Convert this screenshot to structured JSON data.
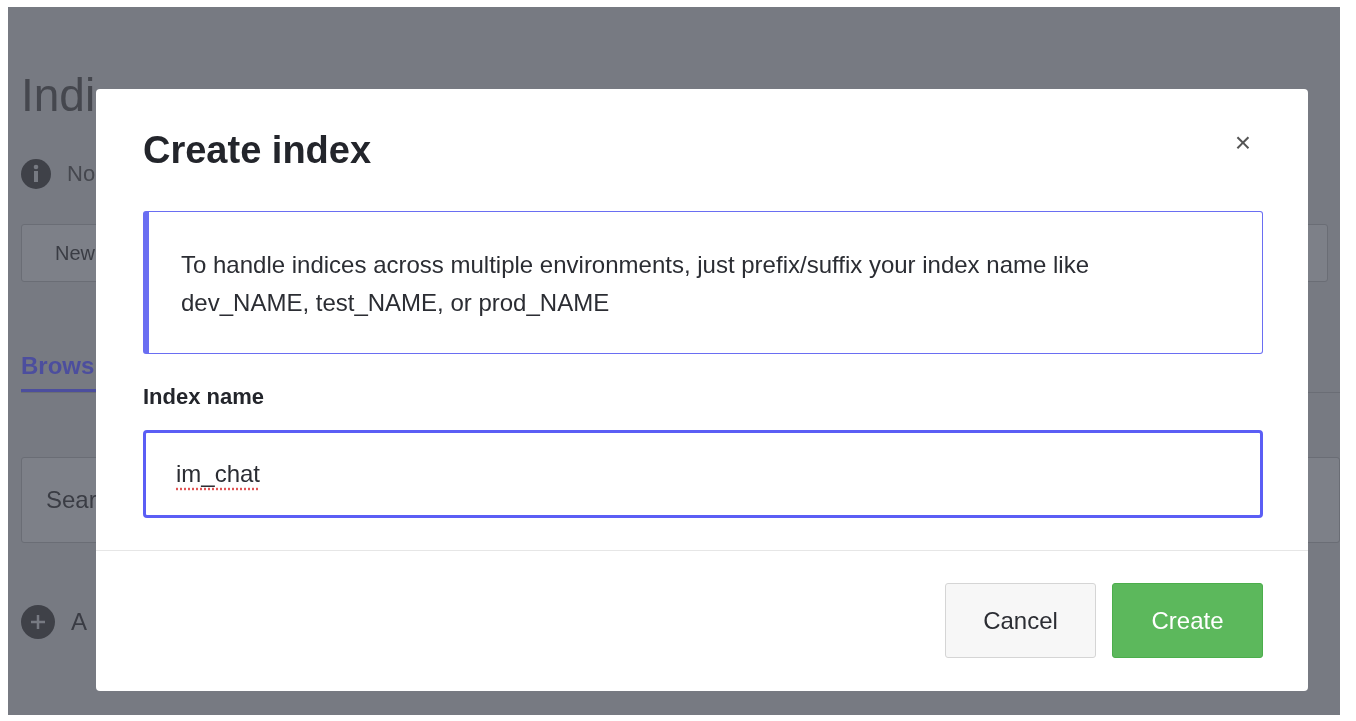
{
  "background": {
    "heading": "Indi",
    "notice": "No",
    "new_button": "New",
    "tabs": [
      {
        "label": "Brows",
        "selected": true
      }
    ],
    "search": {
      "placeholder": "Sear"
    },
    "add_link": "A"
  },
  "dialog": {
    "title": "Create index",
    "close": "×",
    "hint": "To handle indices across multiple environments, just prefix/suffix your index name like dev_NAME, test_NAME, or prod_NAME",
    "field": {
      "label": "Index name",
      "value": "im_chat",
      "spellcheck_error": true
    },
    "buttons": [
      {
        "label": "Cancel",
        "kind": "secondary"
      },
      {
        "label": "Create",
        "kind": "primary"
      }
    ]
  }
}
